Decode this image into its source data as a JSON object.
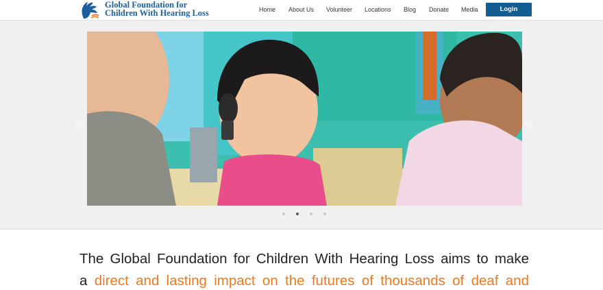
{
  "header": {
    "logo_line1": "Global Foundation for",
    "logo_line2": "Children With Hearing Loss",
    "nav": [
      {
        "label": "Home"
      },
      {
        "label": "About Us"
      },
      {
        "label": "Volunteer"
      },
      {
        "label": "Locations"
      },
      {
        "label": "Blog"
      },
      {
        "label": "Donate"
      },
      {
        "label": "Media"
      }
    ],
    "login_label": "Login"
  },
  "slider": {
    "prev_icon": "chevron-left-icon",
    "next_icon": "chevron-right-icon",
    "slide_count": 4,
    "active_slide": 2
  },
  "mission": {
    "line1": "The Global Foundation for Children With Hearing Loss aims to make",
    "line2_prefix": "a",
    "line2_highlight": "direct and lasting impact on the futures of thousands of deaf and"
  },
  "colors": {
    "brand_blue": "#1d5e9c",
    "login_bg": "#145d92",
    "highlight_orange": "#f07a22"
  }
}
